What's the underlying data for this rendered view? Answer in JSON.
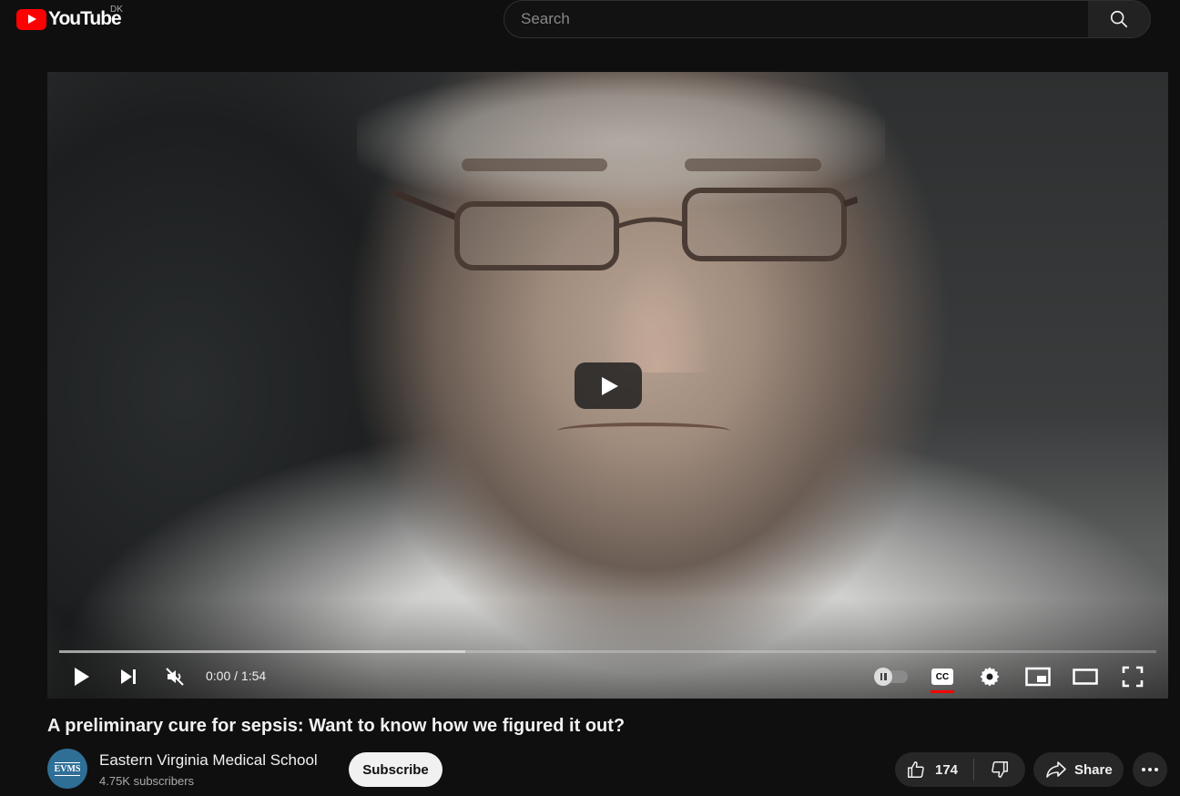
{
  "header": {
    "logo_text": "YouTube",
    "country_code": "DK",
    "search_placeholder": "Search"
  },
  "player": {
    "time_display": "0:00 / 1:54",
    "buffered_fraction": 0.37,
    "autoplay": "off",
    "captions_enabled": true
  },
  "video": {
    "title": "A preliminary cure for sepsis: Want to know how we figured it out?"
  },
  "channel": {
    "avatar_text": "EVMS",
    "name": "Eastern Virginia Medical School",
    "subscribers": "4.75K subscribers",
    "subscribe_label": "Subscribe"
  },
  "actions": {
    "like_count": "174",
    "share_label": "Share"
  },
  "colors": {
    "brand": "#ff0000",
    "background": "#0f0f0f",
    "button_bg": "#272727"
  }
}
